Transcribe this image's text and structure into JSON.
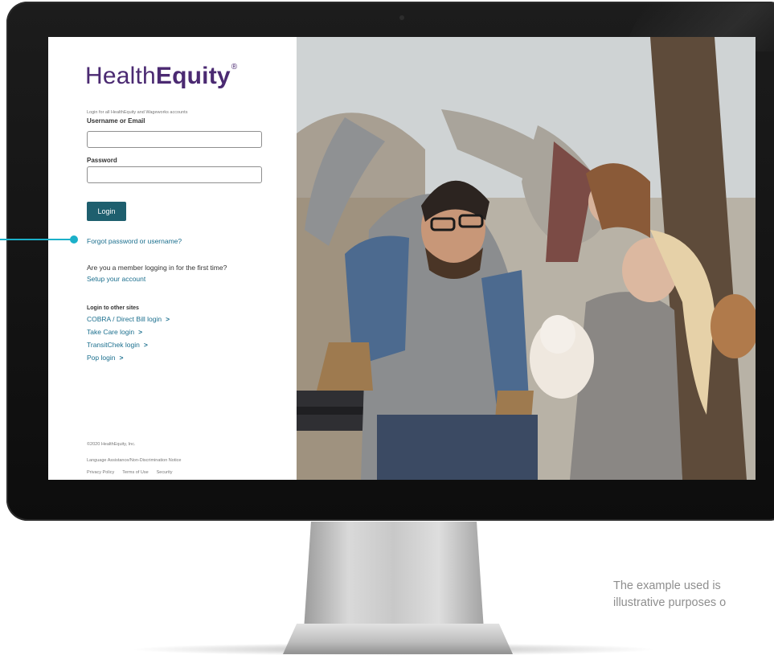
{
  "login": {
    "logo_regular": "Health",
    "logo_bold": "Equity",
    "logo_mark": "®",
    "note": "Login for all HealthEquity and Wageworks accounts",
    "username_label": "Username or Email",
    "username_value": "",
    "password_label": "Password",
    "password_value": "",
    "login_button": "Login",
    "forgot_link": "Forgot password or username?",
    "first_time_text": "Are you a member logging in for the first time?",
    "setup_link": "Setup your account",
    "other_sites_label": "Login to other sites",
    "other_sites": [
      {
        "label": "COBRA / Direct Bill login",
        "chevron": ">"
      },
      {
        "label": "Take Care login",
        "chevron": ">"
      },
      {
        "label": "TransitChek login",
        "chevron": ">"
      },
      {
        "label": "Pop login",
        "chevron": ">"
      }
    ]
  },
  "footer": {
    "copyright": "©2020 HealthEquity, Inc.",
    "language_notice": "Language Assistance/Non-Discrimination Notice",
    "privacy": "Privacy Policy",
    "terms": "Terms of Use",
    "security": "Security"
  },
  "disclaimer": {
    "line1": "The example used is",
    "line2": "illustrative purposes o"
  },
  "colors": {
    "brand_purple": "#4b2a72",
    "button_teal": "#1e5f6e",
    "link_blue": "#1b6f8e",
    "callout_cyan": "#1bb0c9"
  },
  "icons": {
    "chevron": "chevron-right-icon",
    "callout": "callout-pointer-icon"
  }
}
